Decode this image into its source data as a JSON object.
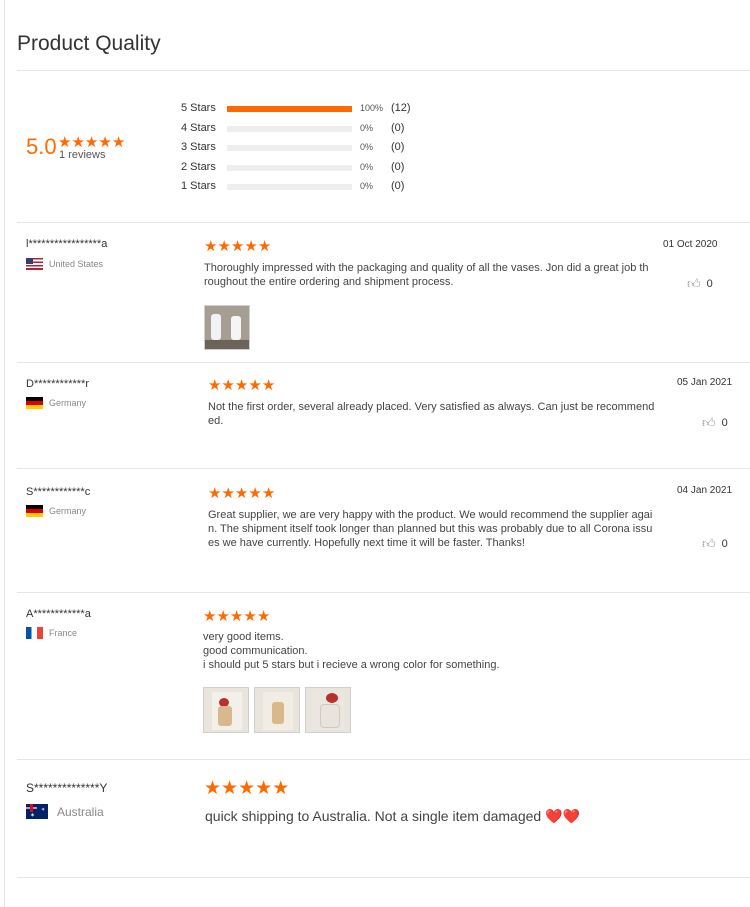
{
  "page": {
    "title": "Product Quality"
  },
  "summary": {
    "score": "5.0",
    "reviews_label": "1 reviews",
    "distribution": [
      {
        "label": "5 Stars",
        "percent": "100%",
        "count": "(12)",
        "fill": 1.0
      },
      {
        "label": "4 Stars",
        "percent": "0%",
        "count": "(0)",
        "fill": 0
      },
      {
        "label": "3 Stars",
        "percent": "0%",
        "count": "(0)",
        "fill": 0
      },
      {
        "label": "2 Stars",
        "percent": "0%",
        "count": "(0)",
        "fill": 0
      },
      {
        "label": "1 Stars",
        "percent": "0%",
        "count": "(0)",
        "fill": 0
      }
    ]
  },
  "colors": {
    "accent": "#ff6a00",
    "divider": "#e6e6e6"
  },
  "reviews": [
    {
      "name": "l*****************a",
      "country": "United States",
      "flag": "us-flag",
      "stars": 5,
      "text": [
        "Thoroughly impressed with the packaging and quality of all the vases. Jon did a great job th",
        "roughout the entire ordering and shipment process."
      ],
      "date": "01 Oct 2020",
      "helpful": "0",
      "images": 1
    },
    {
      "name": "D************r",
      "country": "Germany",
      "flag": "germany-flag",
      "stars": 5,
      "text": [
        "Not the first order, several already placed. Very satisfied as always. Can just be recommend",
        "ed."
      ],
      "date": "05 Jan 2021",
      "helpful": "0",
      "images": 0
    },
    {
      "name": "S************c",
      "country": "Germany",
      "flag": "germany-flag",
      "stars": 5,
      "text": [
        "Great supplier, we are very happy with the product. We would recommend the supplier agai",
        "n. The shipment itself took longer than planned but this was probably due to all Corona issu",
        "es we have currently. Hopefully next time it will be faster. Thanks!"
      ],
      "date": "04 Jan 2021",
      "helpful": "0",
      "images": 0
    },
    {
      "name": "A************a",
      "country": "France",
      "flag": "france-flag",
      "stars": 5,
      "text": [
        "very good items.",
        "good communication.",
        "i should put 5 stars but i recieve a wrong color for something."
      ],
      "date": "",
      "helpful": "",
      "images": 3
    },
    {
      "name": "S**************Y",
      "country": "Australia",
      "flag": "australia-flag",
      "stars": 5,
      "text": [
        "quick shipping to Australia. Not a single item damaged ❤️❤️"
      ],
      "date": "",
      "helpful": "",
      "images": 0
    }
  ]
}
